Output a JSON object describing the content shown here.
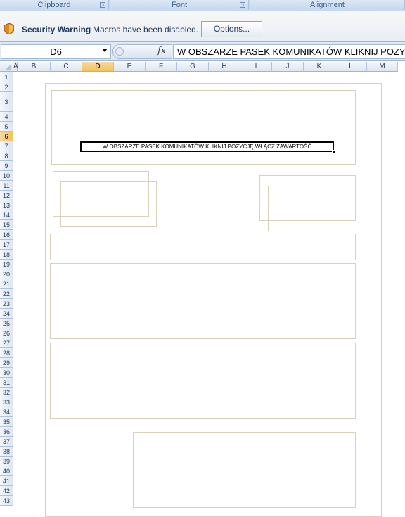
{
  "ribbon": {
    "groups": [
      "Clipboard",
      "Font",
      "Alignment"
    ]
  },
  "message_bar": {
    "title": "Security Warning",
    "message": "Macros have been disabled.",
    "options_label": "Options..."
  },
  "formula_bar": {
    "name_box": "D6",
    "fx_label": "fx",
    "formula": "W OBSZARZE PASEK KOMUNIKATÓW KLIKNIJ POZYCJĘ WŁĄCZ ZAWARTOŚĆ"
  },
  "sheet": {
    "columns": [
      "A",
      "B",
      "C",
      "D",
      "E",
      "F",
      "G",
      "H",
      "I",
      "J",
      "K",
      "L",
      "M"
    ],
    "selected_column": "D",
    "rows": [
      "1",
      "2",
      "3",
      "4",
      "5",
      "6",
      "7",
      "8",
      "9",
      "10",
      "11",
      "12",
      "13",
      "14",
      "15",
      "16",
      "17",
      "18",
      "19",
      "20",
      "21",
      "22",
      "23",
      "24",
      "25",
      "26",
      "27",
      "28",
      "29",
      "30",
      "31",
      "32",
      "33",
      "34",
      "35",
      "36",
      "37",
      "38",
      "39",
      "40",
      "41",
      "42",
      "43"
    ],
    "selected_row": "6",
    "active_cell_text": "W OBSZARZE PASEK KOMUNIKATÓW KLIKNIJ POZYCJĘ WŁĄCZ ZAWARTOŚĆ"
  },
  "colors": {
    "header_bg": "#dde6f2",
    "selected_header": "#f1c15f",
    "frame_border": "#d8d2bd",
    "message_text": "#1e395b"
  }
}
